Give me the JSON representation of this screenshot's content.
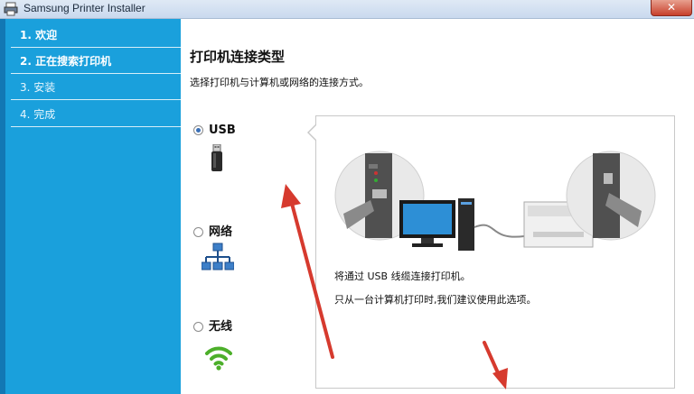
{
  "window": {
    "title": "Samsung Printer Installer",
    "close_glyph": "✕"
  },
  "steps": [
    {
      "label": "1. 欢迎"
    },
    {
      "label": "2. 正在搜索打印机"
    },
    {
      "label": "3. 安装"
    },
    {
      "label": "4. 完成"
    }
  ],
  "main": {
    "heading": "打印机连接类型",
    "subheading": "选择打印机与计算机或网络的连接方式。"
  },
  "options": [
    {
      "label": "USB",
      "selected": true,
      "icon": "usb-icon"
    },
    {
      "label": "网络",
      "selected": false,
      "icon": "network-icon"
    },
    {
      "label": "无线",
      "selected": false,
      "icon": "wifi-icon"
    }
  ],
  "panel": {
    "line1": "将通过 USB 线缆连接打印机。",
    "line2": "只从一台计算机打印时,我们建议使用此选项。"
  },
  "colors": {
    "sidebar": "#1aa0dc",
    "sidebar_border": "#1278b4",
    "arrow": "#d63a2e",
    "wifi": "#4caf2a"
  }
}
